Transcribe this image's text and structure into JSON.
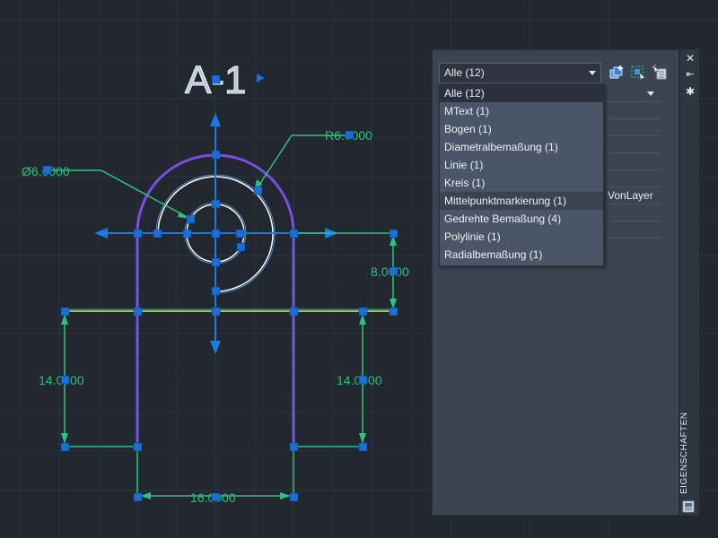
{
  "drawing": {
    "label_text": "A-1",
    "dims": {
      "diameter": "Ø6.0000",
      "radius": "R6.0000",
      "height_right_top": "8.0000",
      "height_left": "14.0000",
      "height_right": "14.0000",
      "width_bottom": "16.0000"
    }
  },
  "palette": {
    "title": "EIGENSCHAFTEN",
    "filter_selected": "Alle (12)",
    "filter_options": [
      "Alle (12)",
      "MText (1)",
      "Bogen (1)",
      "Diametralbemaßung (1)",
      "Linie (1)",
      "Kreis (1)",
      "Mittelpunktmarkierung (1)",
      "Gedrehte Bemaßung (4)",
      "Polylinie (1)",
      "Radialbemaßung (1)"
    ],
    "selected_index": 0,
    "hover_index": 6,
    "visible_values": [
      "VonLayer"
    ],
    "close_symbol": "✕",
    "autohide_symbol": "⇤",
    "settings_symbol": "✱"
  },
  "colors": {
    "background": "#212830",
    "geometry": "#ffffff",
    "dimension": "#2ec27e",
    "polyline": "#7b4ee0",
    "grip": "#1a6fd8",
    "palette_bg": "#3b4453"
  }
}
